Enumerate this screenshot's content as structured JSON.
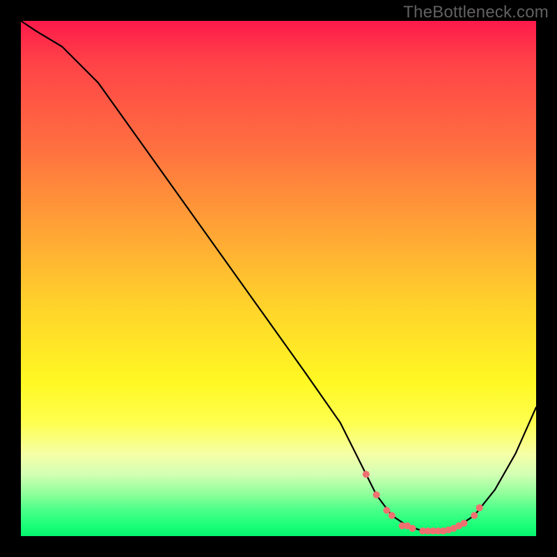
{
  "watermark": "TheBottleneck.com",
  "chart_data": {
    "type": "line",
    "title": "",
    "xlabel": "",
    "ylabel": "",
    "xlim": [
      0,
      100
    ],
    "ylim": [
      0,
      100
    ],
    "background": "rainbow-vertical",
    "series": [
      {
        "name": "curve",
        "x": [
          0,
          3,
          8,
          15,
          25,
          35,
          45,
          55,
          62,
          66,
          69,
          72,
          75,
          78,
          81,
          83,
          85,
          88,
          92,
          96,
          100
        ],
        "y": [
          100,
          98,
          95,
          88,
          74,
          60,
          46,
          32,
          22,
          14,
          8,
          4,
          2,
          1,
          1,
          1,
          2,
          4,
          9,
          16,
          25
        ]
      }
    ],
    "markers": {
      "name": "highlight-dots",
      "color": "#f07070",
      "x": [
        67,
        69,
        71,
        72,
        74,
        75,
        76,
        78,
        79,
        80,
        81,
        82,
        83,
        84,
        85,
        86,
        88,
        89
      ],
      "y": [
        12,
        8,
        5,
        4,
        2,
        2,
        1.5,
        1,
        1,
        1,
        1,
        1,
        1.2,
        1.5,
        2,
        2.5,
        4,
        5.5
      ]
    }
  }
}
